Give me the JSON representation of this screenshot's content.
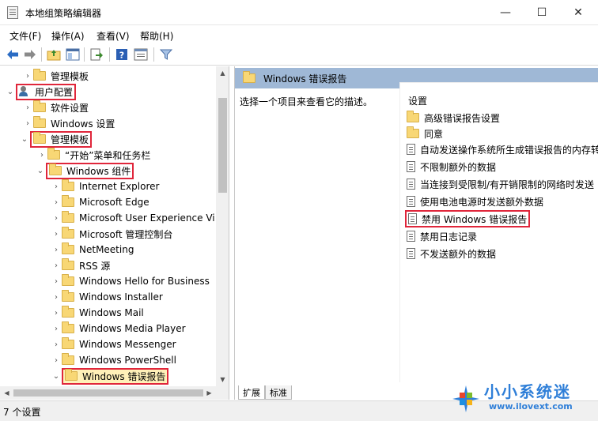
{
  "window": {
    "title": "本地组策略编辑器",
    "minimize": "—",
    "maximize": "☐",
    "close": "✕"
  },
  "menu": {
    "file": "文件(F)",
    "action": "操作(A)",
    "view": "查看(V)",
    "help": "帮助(H)"
  },
  "toolbar": {
    "icons": [
      "back-icon",
      "forward-icon",
      "up-folder-icon",
      "show-tree-icon",
      "export-list-icon",
      "help-icon",
      "properties-icon",
      "filter-icon"
    ]
  },
  "tree": {
    "items": [
      {
        "label": "管理模板",
        "level": 2
      },
      {
        "label": "用户配置",
        "level": 0,
        "highlight": true
      },
      {
        "label": "软件设置",
        "level": 1
      },
      {
        "label": "Windows 设置",
        "level": 1
      },
      {
        "label": "管理模板",
        "level": 1,
        "highlight": true
      },
      {
        "label": "“开始”菜单和任务栏",
        "level": 2
      },
      {
        "label": "Windows 组件",
        "level": 2,
        "highlight": true
      },
      {
        "label": "Internet Explorer",
        "level": 3
      },
      {
        "label": "Microsoft Edge",
        "level": 3
      },
      {
        "label": "Microsoft User Experience Vi",
        "level": 3
      },
      {
        "label": "Microsoft 管理控制台",
        "level": 3
      },
      {
        "label": "NetMeeting",
        "level": 3
      },
      {
        "label": "RSS 源",
        "level": 3
      },
      {
        "label": "Windows Hello for Business",
        "level": 3
      },
      {
        "label": "Windows Installer",
        "level": 3
      },
      {
        "label": "Windows Mail",
        "level": 3
      },
      {
        "label": "Windows Media Player",
        "level": 3
      },
      {
        "label": "Windows Messenger",
        "level": 3
      },
      {
        "label": "Windows PowerShell",
        "level": 3
      },
      {
        "label": "Windows 错误报告",
        "level": 3,
        "highlight": true,
        "selected": true
      }
    ]
  },
  "right": {
    "header": "Windows 错误报告",
    "description": "选择一个项目来查看它的描述。",
    "column_header": "设置",
    "items": [
      {
        "label": "高级错误报告设置",
        "kind": "folder"
      },
      {
        "label": "同意",
        "kind": "folder"
      },
      {
        "label": "自动发送操作系统所生成错误报告的内存转",
        "kind": "setting"
      },
      {
        "label": "不限制额外的数据",
        "kind": "setting"
      },
      {
        "label": "当连接到受限制/有开销限制的网络时发送",
        "kind": "setting"
      },
      {
        "label": "使用电池电源时发送额外数据",
        "kind": "setting"
      },
      {
        "label": "禁用 Windows 错误报告",
        "kind": "setting",
        "highlight": true
      },
      {
        "label": "禁用日志记录",
        "kind": "setting"
      },
      {
        "label": "不发送额外的数据",
        "kind": "setting"
      }
    ],
    "tabs": [
      "扩展",
      "标准"
    ]
  },
  "status": {
    "text": "7 个设置"
  },
  "watermark": {
    "name": "小小系统迷",
    "url": "www.ilovext.com"
  },
  "colors": {
    "highlight_border": "#e0263b",
    "header_bg": "#9fb8d6",
    "folder": "#f8d775",
    "watermark": "#2f7fd8"
  }
}
